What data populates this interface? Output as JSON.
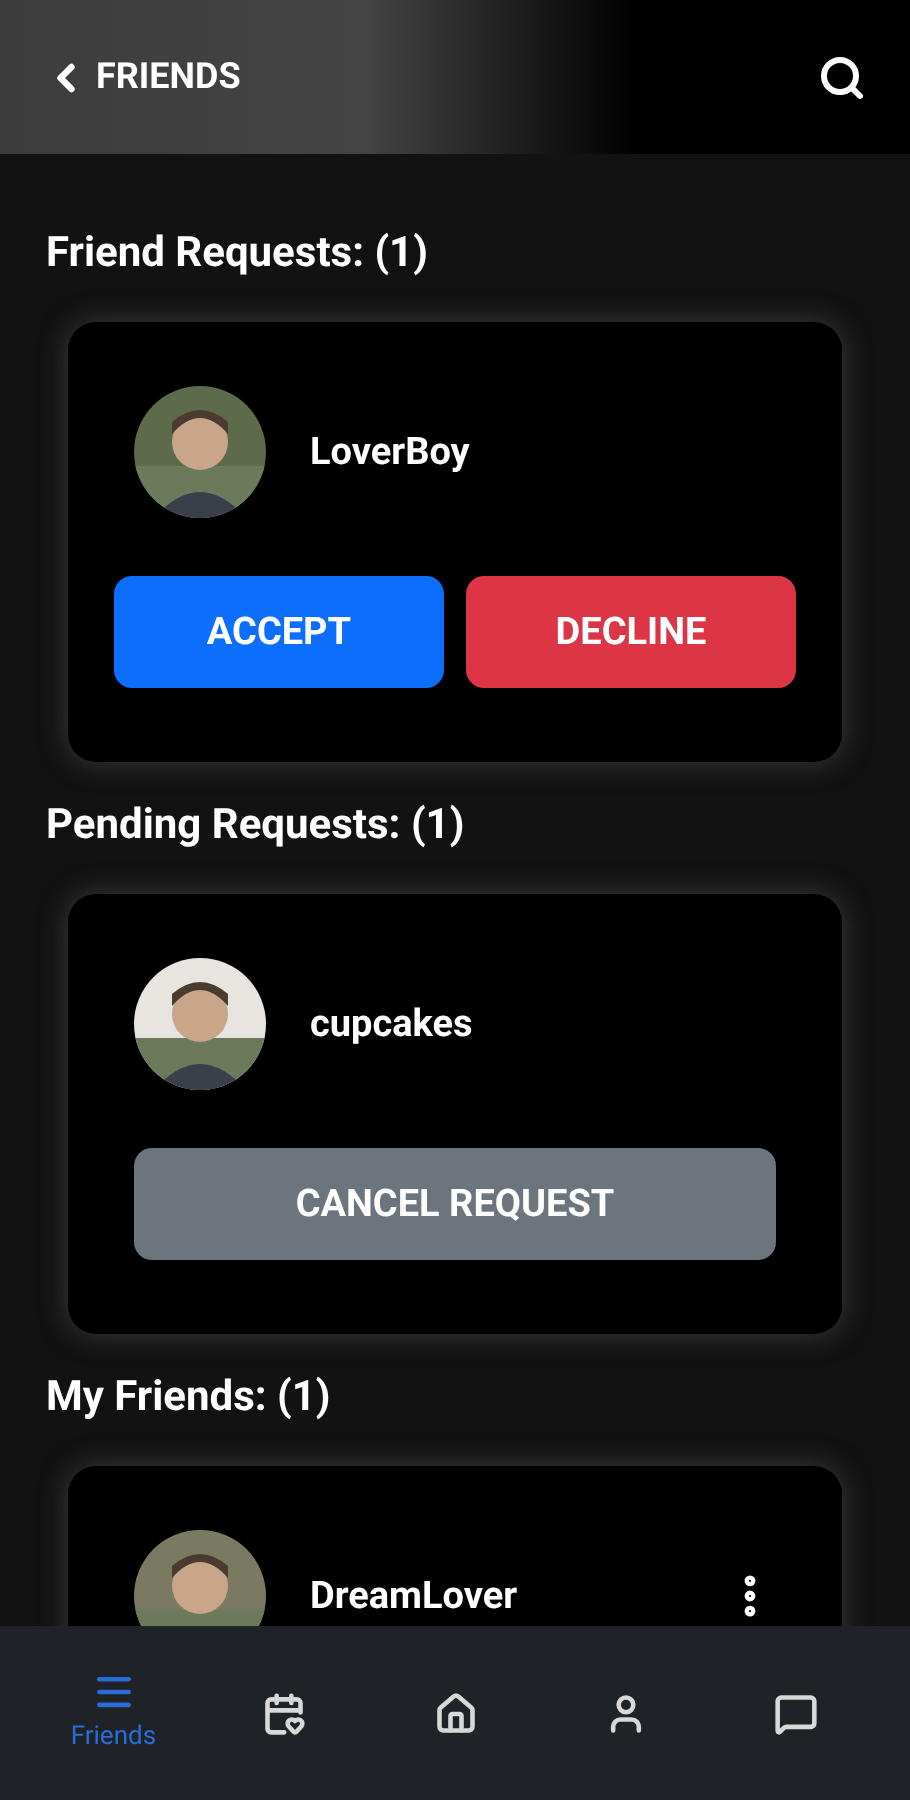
{
  "header": {
    "title": "FRIENDS"
  },
  "friend_requests": {
    "title": "Friend Requests: (1)",
    "items": [
      {
        "name": "LoverBoy",
        "buttons": [
          {
            "kind": "accept",
            "label": "ACCEPT"
          },
          {
            "kind": "decline",
            "label": "DECLINE"
          }
        ]
      }
    ]
  },
  "pending_requests": {
    "title": "Pending Requests: (1)",
    "items": [
      {
        "name": "cupcakes",
        "buttons": [
          {
            "kind": "cancel",
            "label": "CANCEL REQUEST"
          }
        ]
      }
    ]
  },
  "my_friends": {
    "title": "My Friends: (1)",
    "items": [
      {
        "name": "DreamLover"
      }
    ]
  },
  "nav": [
    {
      "kind": "menu",
      "label": "Friends",
      "selected": true
    },
    {
      "kind": "calendar",
      "selected": false
    },
    {
      "kind": "home",
      "selected": false
    },
    {
      "kind": "person",
      "selected": false
    },
    {
      "kind": "chat",
      "selected": false
    }
  ]
}
